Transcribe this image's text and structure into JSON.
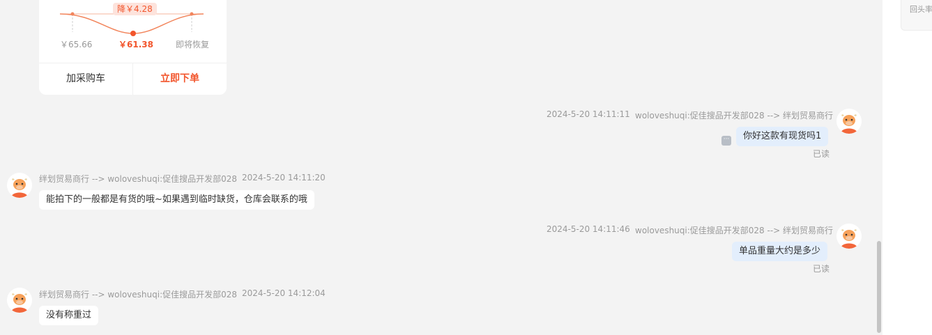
{
  "product_card": {
    "discount_badge": "降￥4.28",
    "price_original": "￥65.66",
    "price_current": "￥61.38",
    "price_future": "即将恢复",
    "add_cart_label": "加采购车",
    "buy_now_label": "立即下单",
    "colors": {
      "accent": "#f2552c",
      "line": "#f2855c"
    }
  },
  "messages": [
    {
      "direction": "out",
      "time": "2024-5-20 14:11:11",
      "route": "woloveshuqi:促佳搜品开发部028 --> 绊划贸易商行",
      "text": "你好这款有现货吗1",
      "status": "已读"
    },
    {
      "direction": "in",
      "route": "绊划贸易商行 --> woloveshuqi:促佳搜品开发部028",
      "time": "2024-5-20 14:11:20",
      "text": "能拍下的一般都是有货的哦~如果遇到临时缺货，仓库会联系的哦"
    },
    {
      "direction": "out",
      "time": "2024-5-20 14:11:46",
      "route": "woloveshuqi:促佳搜品开发部028 --> 绊划贸易商行",
      "text": "单品重量大约是多少",
      "status": "已读"
    },
    {
      "direction": "in",
      "route": "绊划贸易商行 --> woloveshuqi:促佳搜品开发部028",
      "time": "2024-5-20 14:12:04",
      "text": "没有称重过"
    }
  ],
  "right_panel": {
    "partial_text": "回头率"
  },
  "icons": {
    "avatar": "cow-avatar-icon",
    "more": "more-options-icon"
  },
  "colors": {
    "bubble_out": "#e3eefc",
    "bubble_in": "#ffffff",
    "background": "#f3f3f3"
  }
}
